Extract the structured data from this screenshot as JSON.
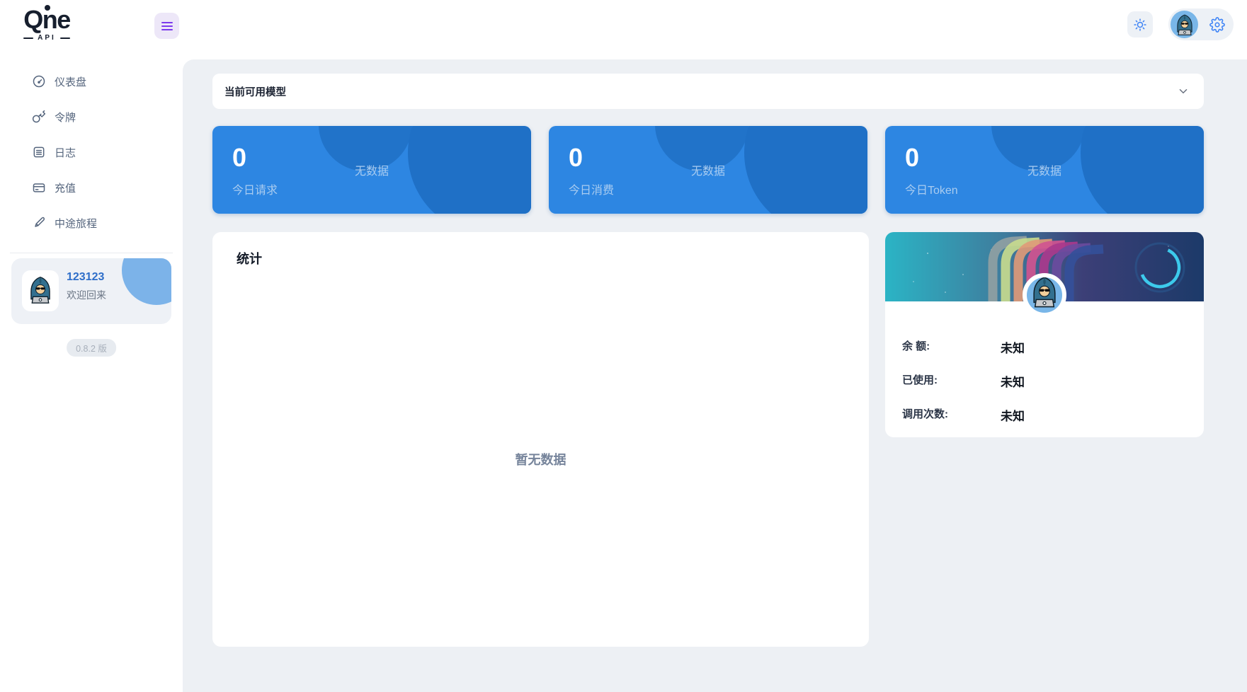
{
  "brand": {
    "name": "Qne",
    "sub": "API"
  },
  "sidebar": {
    "items": [
      {
        "label": "仪表盘",
        "icon": "gauge-icon"
      },
      {
        "label": "令牌",
        "icon": "key-icon"
      },
      {
        "label": "日志",
        "icon": "log-icon"
      },
      {
        "label": "充值",
        "icon": "credit-card-icon"
      },
      {
        "label": "中途旅程",
        "icon": "brush-icon"
      }
    ],
    "user": {
      "name": "123123",
      "greeting": "欢迎回来"
    },
    "version": "0.8.2 版"
  },
  "header": {
    "icons": [
      "menu-icon",
      "sun-icon",
      "user-avatar",
      "gear-icon"
    ]
  },
  "models_panel": {
    "title": "当前可用模型",
    "state_icon": "chevron-down-icon"
  },
  "stat_cards": [
    {
      "value": "0",
      "label": "今日请求",
      "empty": "无数据"
    },
    {
      "value": "0",
      "label": "今日消费",
      "empty": "无数据"
    },
    {
      "value": "0",
      "label": "今日Token",
      "empty": "无数据"
    }
  ],
  "stats_panel": {
    "title": "统计",
    "empty": "暂无数据"
  },
  "profile_card": {
    "rows": [
      {
        "label": "余 额:",
        "value": "未知"
      },
      {
        "label": "已使用:",
        "value": "未知"
      },
      {
        "label": "调用次数:",
        "value": "未知"
      }
    ]
  },
  "colors": {
    "card_blue": "#2d86e2",
    "card_blue_dark": "#1f70c6",
    "accent_purple": "#7c3aed",
    "icon_blue": "#3b82f6",
    "username_blue": "#2e6ec9",
    "content_bg": "#edf0f4",
    "empty_text": "#76849b",
    "avatar_bg": "#79b6e8"
  }
}
